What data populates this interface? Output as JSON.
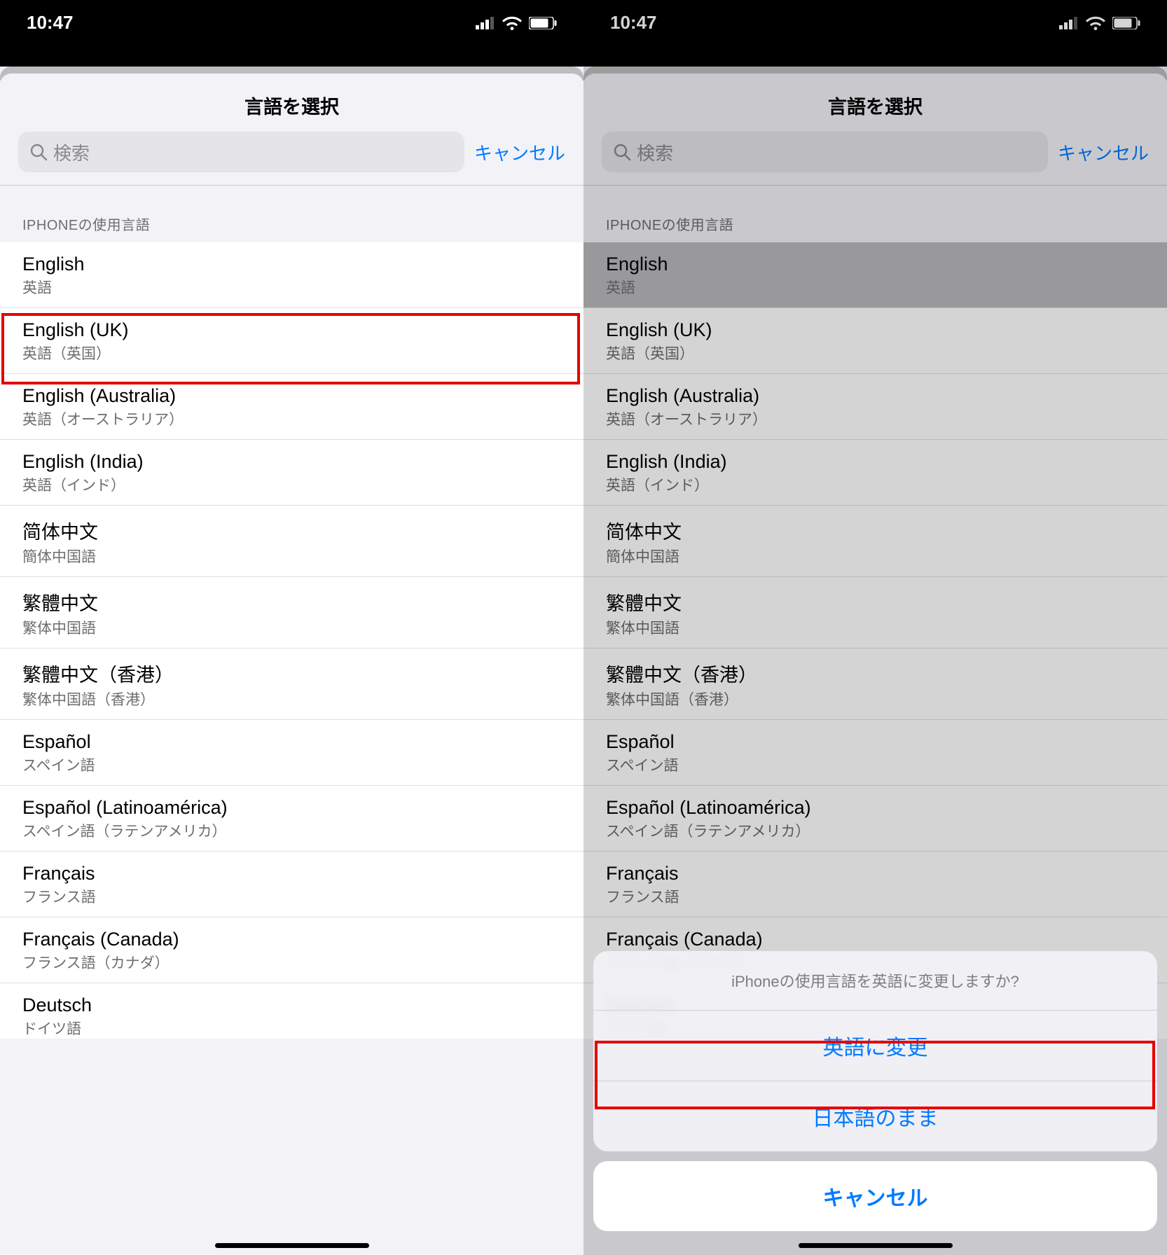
{
  "status": {
    "time": "10:47"
  },
  "header": {
    "title": "言語を選択"
  },
  "search": {
    "placeholder": "検索",
    "cancel": "キャンセル"
  },
  "section": {
    "header": "IPHONEの使用言語"
  },
  "languages": [
    {
      "primary": "English",
      "secondary": "英語"
    },
    {
      "primary": "English (UK)",
      "secondary": "英語（英国）"
    },
    {
      "primary": "English (Australia)",
      "secondary": "英語（オーストラリア）"
    },
    {
      "primary": "English (India)",
      "secondary": "英語（インド）"
    },
    {
      "primary": "简体中文",
      "secondary": "簡体中国語"
    },
    {
      "primary": "繁體中文",
      "secondary": "繁体中国語"
    },
    {
      "primary": "繁體中文（香港）",
      "secondary": "繁体中国語（香港）"
    },
    {
      "primary": "Español",
      "secondary": "スペイン語"
    },
    {
      "primary": "Español (Latinoamérica)",
      "secondary": "スペイン語（ラテンアメリカ）"
    },
    {
      "primary": "Français",
      "secondary": "フランス語"
    },
    {
      "primary": "Français (Canada)",
      "secondary": "フランス語（カナダ）"
    },
    {
      "primary": "Deutsch",
      "secondary": "ドイツ語"
    }
  ],
  "actionSheet": {
    "title": "iPhoneの使用言語を英語に変更しますか?",
    "change": "英語に変更",
    "keep": "日本語のまま",
    "cancel": "キャンセル"
  }
}
